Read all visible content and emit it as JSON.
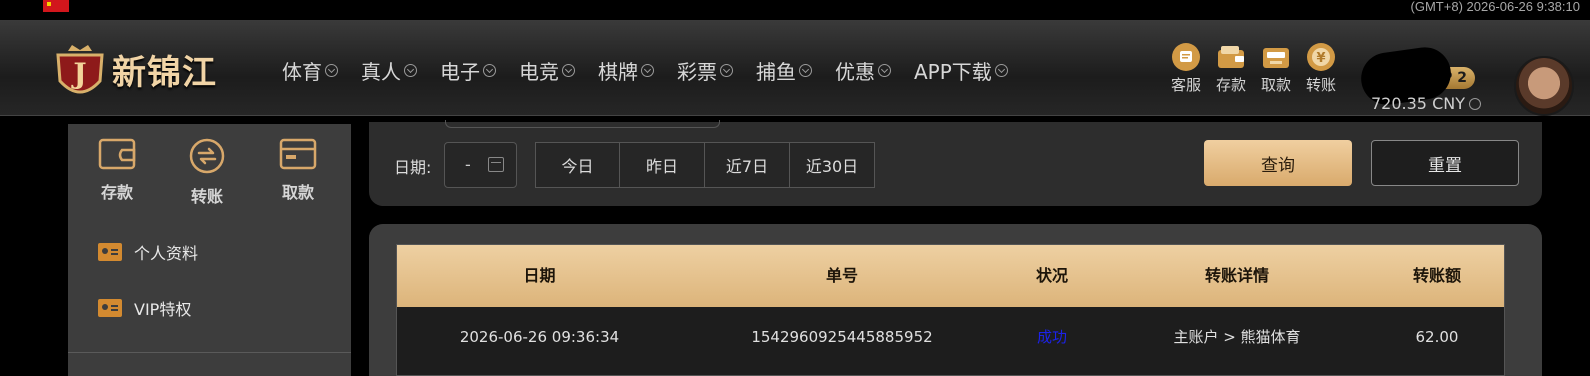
{
  "topbar": {
    "timezone_time": "(GMT+8) 2026-06-26 9:38:10"
  },
  "brand": {
    "logo_text": "新锦江"
  },
  "nav": [
    {
      "label": "体育"
    },
    {
      "label": "真人"
    },
    {
      "label": "电子"
    },
    {
      "label": "电竞"
    },
    {
      "label": "棋牌"
    },
    {
      "label": "彩票"
    },
    {
      "label": "捕鱼"
    },
    {
      "label": "优惠"
    },
    {
      "label": "APP下载"
    }
  ],
  "quick_actions": [
    {
      "label": "客服",
      "icon": "chat-icon"
    },
    {
      "label": "存款",
      "icon": "wallet-icon"
    },
    {
      "label": "取款",
      "icon": "atm-icon"
    },
    {
      "label": "转账",
      "icon": "exchange-icon"
    }
  ],
  "account": {
    "vip": "IP 2",
    "balance": "720.35 CNY"
  },
  "sidebar": {
    "actions": [
      {
        "label": "存款",
        "icon": "wallet-icon"
      },
      {
        "label": "转账",
        "icon": "transfer-icon"
      },
      {
        "label": "取款",
        "icon": "card-icon"
      }
    ],
    "menu": [
      {
        "label": "个人资料",
        "icon": "id-card-icon"
      },
      {
        "label": "VIP特权",
        "icon": "id-card-icon"
      }
    ]
  },
  "filter": {
    "date_label": "日期:",
    "date_value": "-",
    "ranges": [
      "今日",
      "昨日",
      "近7日",
      "近30日"
    ],
    "query_label": "查询",
    "reset_label": "重置"
  },
  "table": {
    "headers": [
      "日期",
      "单号",
      "状况",
      "转账详情",
      "转账额"
    ],
    "rows": [
      [
        "2026-06-26 09:36:34",
        "1542960925445885952",
        "成功",
        "主账户 > 熊猫体育",
        "62.00"
      ]
    ]
  },
  "colors": {
    "accent_gold": "#dcb47a",
    "status_success": "#1c22e8",
    "panel": "#3d3d3d"
  }
}
